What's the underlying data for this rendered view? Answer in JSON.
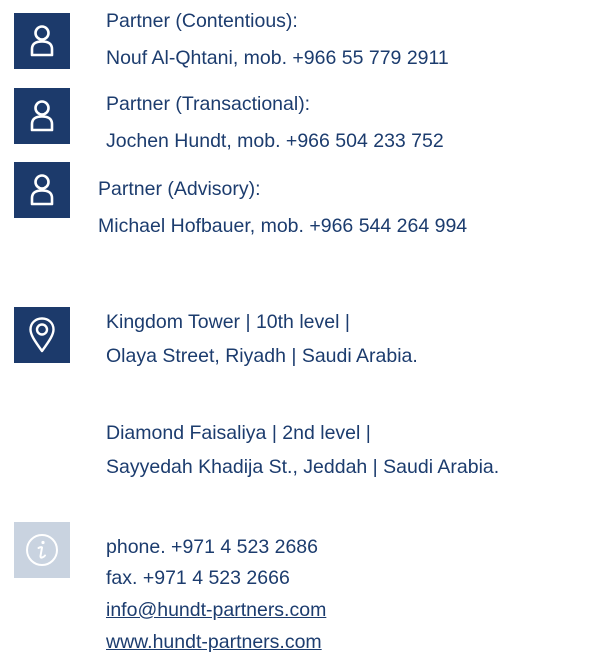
{
  "colors": {
    "icon_bg_dark": "#1c3a6b",
    "icon_bg_light": "#c9d3e0",
    "text": "#1c3c6e"
  },
  "contacts": [
    {
      "icon": "person-icon",
      "role": "Partner (Contentious):",
      "detail": "Nouf Al-Qhtani, mob. +966 55 779 2911"
    },
    {
      "icon": "person-icon",
      "role": "Partner (Transactional):",
      "detail": "Jochen Hundt, mob. +966 504 233 752"
    },
    {
      "icon": "person-icon",
      "role": "Partner (Advisory):",
      "detail": "Michael Hofbauer, mob. +966 544 264 994"
    }
  ],
  "addresses": {
    "icon": "location-pin-icon",
    "riyadh": {
      "line1": "Kingdom Tower | 10th level |",
      "line2": "Olaya Street, Riyadh | Saudi Arabia."
    },
    "jeddah": {
      "line1": "Diamond Faisaliya | 2nd level |",
      "line2": "Sayyedah Khadija St., Jeddah | Saudi Arabia."
    }
  },
  "info": {
    "icon": "info-icon",
    "phone": "phone. +971 4 523 2686",
    "fax": "fax. +971 4 523 2666",
    "email": "info@hundt-partners.com",
    "website": "www.hundt-partners.com"
  }
}
